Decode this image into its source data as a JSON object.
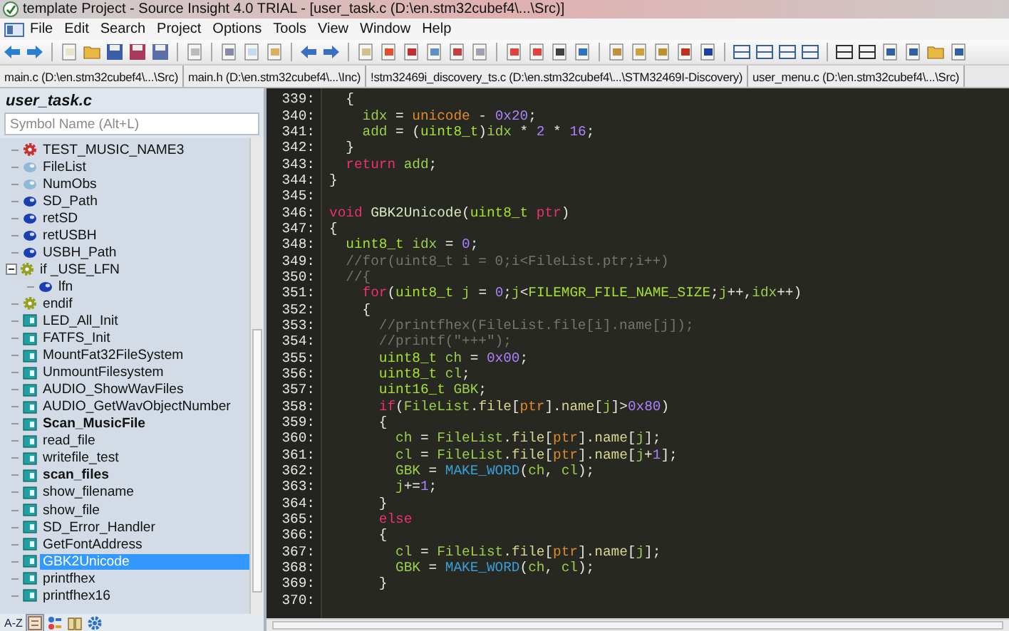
{
  "window": {
    "title": "template Project - Source Insight 4.0 TRIAL - [user_task.c (D:\\en.stm32cubef4\\...\\Src)]"
  },
  "menu": [
    "File",
    "Edit",
    "Search",
    "Project",
    "Options",
    "Tools",
    "View",
    "Window",
    "Help"
  ],
  "tabs": [
    {
      "label": "main.c (D:\\en.stm32cubef4\\...\\Src)",
      "selected": false
    },
    {
      "label": "main.h (D:\\en.stm32cubef4\\...\\Inc)",
      "selected": false
    },
    {
      "label": "!stm32469i_discovery_ts.c (D:\\en.stm32cubef4\\...\\STM32469I-Discovery)",
      "selected": false
    },
    {
      "label": "user_menu.c (D:\\en.stm32cubef4\\...\\Src)",
      "selected": false
    }
  ],
  "sidebar": {
    "title": "user_task.c",
    "search": {
      "placeholder": "Symbol Name (Alt+L)"
    },
    "sort_label": "A-Z",
    "items": [
      {
        "label": "TEST_MUSIC_NAME3",
        "kind": "define",
        "bold": false,
        "selected": false
      },
      {
        "label": "FileList",
        "kind": "variable-local",
        "bold": false,
        "selected": false
      },
      {
        "label": "NumObs",
        "kind": "variable-local",
        "bold": false,
        "selected": false
      },
      {
        "label": "SD_Path",
        "kind": "variable",
        "bold": false,
        "selected": false
      },
      {
        "label": "retSD",
        "kind": "variable",
        "bold": false,
        "selected": false
      },
      {
        "label": "retUSBH",
        "kind": "variable",
        "bold": false,
        "selected": false
      },
      {
        "label": "USBH_Path",
        "kind": "variable",
        "bold": false,
        "selected": false
      },
      {
        "label": "if _USE_LFN",
        "kind": "condition",
        "bold": false,
        "selected": false,
        "expanded": true,
        "children": [
          {
            "label": "lfn",
            "kind": "variable",
            "bold": false,
            "selected": false
          }
        ]
      },
      {
        "label": "endif",
        "kind": "condition",
        "bold": false,
        "selected": false
      },
      {
        "label": "LED_All_Init",
        "kind": "function",
        "bold": false,
        "selected": false
      },
      {
        "label": "FATFS_Init",
        "kind": "function",
        "bold": false,
        "selected": false
      },
      {
        "label": "MountFat32FileSystem",
        "kind": "function",
        "bold": false,
        "selected": false
      },
      {
        "label": "UnmountFilesystem",
        "kind": "function",
        "bold": false,
        "selected": false
      },
      {
        "label": "AUDIO_ShowWavFiles",
        "kind": "function",
        "bold": false,
        "selected": false
      },
      {
        "label": "AUDIO_GetWavObjectNumber",
        "kind": "function",
        "bold": false,
        "selected": false
      },
      {
        "label": "Scan_MusicFile",
        "kind": "function",
        "bold": true,
        "selected": false
      },
      {
        "label": "read_file",
        "kind": "function",
        "bold": false,
        "selected": false
      },
      {
        "label": "writefile_test",
        "kind": "function",
        "bold": false,
        "selected": false
      },
      {
        "label": "scan_files",
        "kind": "function",
        "bold": true,
        "selected": false
      },
      {
        "label": "show_filename",
        "kind": "function",
        "bold": false,
        "selected": false
      },
      {
        "label": "show_file",
        "kind": "function",
        "bold": false,
        "selected": false
      },
      {
        "label": "SD_Error_Handler",
        "kind": "function",
        "bold": false,
        "selected": false
      },
      {
        "label": "GetFontAddress",
        "kind": "function",
        "bold": false,
        "selected": false
      },
      {
        "label": "GBK2Unicode",
        "kind": "function",
        "bold": false,
        "selected": true
      },
      {
        "label": "printfhex",
        "kind": "function",
        "bold": false,
        "selected": false
      },
      {
        "label": "printfhex16",
        "kind": "function",
        "bold": false,
        "selected": false
      }
    ]
  },
  "editor": {
    "lines": [
      {
        "number": "339:",
        "tokens": [
          {
            "kind": "p",
            "text": "  {"
          }
        ]
      },
      {
        "number": "340:",
        "tokens": [
          {
            "kind": "id",
            "text": "    idx"
          },
          {
            "kind": "p",
            "text": " = "
          },
          {
            "kind": "param",
            "text": "unicode"
          },
          {
            "kind": "p",
            "text": " - "
          },
          {
            "kind": "num",
            "text": "0x20"
          },
          {
            "kind": "p",
            "text": ";"
          }
        ]
      },
      {
        "number": "341:",
        "tokens": [
          {
            "kind": "id",
            "text": "    add"
          },
          {
            "kind": "p",
            "text": " = ("
          },
          {
            "kind": "type",
            "text": "uint8_t"
          },
          {
            "kind": "p",
            "text": ")"
          },
          {
            "kind": "id",
            "text": "idx"
          },
          {
            "kind": "p",
            "text": " * "
          },
          {
            "kind": "num",
            "text": "2"
          },
          {
            "kind": "p",
            "text": " * "
          },
          {
            "kind": "num",
            "text": "16"
          },
          {
            "kind": "p",
            "text": ";"
          }
        ]
      },
      {
        "number": "342:",
        "tokens": [
          {
            "kind": "p",
            "text": "  }"
          }
        ]
      },
      {
        "number": "343:",
        "tokens": [
          {
            "kind": "kw",
            "text": "  return"
          },
          {
            "kind": "id",
            "text": " add"
          },
          {
            "kind": "p",
            "text": ";"
          }
        ]
      },
      {
        "number": "344:",
        "tokens": [
          {
            "kind": "p",
            "text": "}"
          }
        ]
      },
      {
        "number": "345:"
      },
      {
        "number": "346:",
        "tokens": [
          {
            "kind": "kw",
            "text": "void"
          },
          {
            "kind": "fn",
            "text": " GBK2Unicode"
          },
          {
            "kind": "p",
            "text": "("
          },
          {
            "kind": "type",
            "text": "uint8_t"
          },
          {
            "kind": "kw",
            "text": " ptr"
          },
          {
            "kind": "p",
            "text": ")"
          }
        ]
      },
      {
        "number": "347:",
        "tokens": [
          {
            "kind": "p",
            "text": "{"
          }
        ]
      },
      {
        "number": "348:",
        "tokens": [
          {
            "kind": "type",
            "text": "  uint8_t"
          },
          {
            "kind": "id",
            "text": " idx"
          },
          {
            "kind": "p",
            "text": " = "
          },
          {
            "kind": "num",
            "text": "0"
          },
          {
            "kind": "p",
            "text": ";"
          }
        ]
      },
      {
        "number": "349:",
        "tokens": [
          {
            "kind": "cm",
            "text": "  //for(uint8_t i = 0;i<FileList.ptr;i++)"
          }
        ]
      },
      {
        "number": "350:",
        "tokens": [
          {
            "kind": "cm",
            "text": "  //{"
          }
        ]
      },
      {
        "number": "351:",
        "tokens": [
          {
            "kind": "kw",
            "text": "    for"
          },
          {
            "kind": "p",
            "text": "("
          },
          {
            "kind": "type",
            "text": "uint8_t"
          },
          {
            "kind": "id",
            "text": " j"
          },
          {
            "kind": "p",
            "text": " = "
          },
          {
            "kind": "num",
            "text": "0"
          },
          {
            "kind": "p",
            "text": ";"
          },
          {
            "kind": "id",
            "text": "j"
          },
          {
            "kind": "p",
            "text": "<"
          },
          {
            "kind": "const",
            "text": "FILEMGR_FILE_NAME_SIZE"
          },
          {
            "kind": "p",
            "text": ";"
          },
          {
            "kind": "id",
            "text": "j"
          },
          {
            "kind": "p",
            "text": "++,"
          },
          {
            "kind": "id",
            "text": "idx"
          },
          {
            "kind": "p",
            "text": "++)"
          }
        ]
      },
      {
        "number": "352:",
        "tokens": [
          {
            "kind": "p",
            "text": "    {"
          }
        ]
      },
      {
        "number": "353:",
        "tokens": [
          {
            "kind": "cm",
            "text": "      //printfhex(FileList.file[i].name[j]);"
          }
        ]
      },
      {
        "number": "354:",
        "tokens": [
          {
            "kind": "cm",
            "text": "      //printf(\"+++\");"
          }
        ]
      },
      {
        "number": "355:",
        "tokens": [
          {
            "kind": "type",
            "text": "      uint8_t"
          },
          {
            "kind": "id",
            "text": " ch"
          },
          {
            "kind": "p",
            "text": " = "
          },
          {
            "kind": "num",
            "text": "0x00"
          },
          {
            "kind": "p",
            "text": ";"
          }
        ]
      },
      {
        "number": "356:",
        "tokens": [
          {
            "kind": "type",
            "text": "      uint8_t"
          },
          {
            "kind": "id",
            "text": " cl"
          },
          {
            "kind": "p",
            "text": ";"
          }
        ]
      },
      {
        "number": "357:",
        "tokens": [
          {
            "kind": "type",
            "text": "      uint16_t"
          },
          {
            "kind": "id",
            "text": " GBK"
          },
          {
            "kind": "p",
            "text": ";"
          }
        ]
      },
      {
        "number": "358:",
        "tokens": [
          {
            "kind": "kw",
            "text": "      if"
          },
          {
            "kind": "p",
            "text": "("
          },
          {
            "kind": "id",
            "text": "FileList"
          },
          {
            "kind": "p",
            "text": "."
          },
          {
            "kind": "mem",
            "text": "file"
          },
          {
            "kind": "p",
            "text": "["
          },
          {
            "kind": "param",
            "text": "ptr"
          },
          {
            "kind": "p",
            "text": "]."
          },
          {
            "kind": "mem",
            "text": "name"
          },
          {
            "kind": "p",
            "text": "["
          },
          {
            "kind": "id",
            "text": "j"
          },
          {
            "kind": "p",
            "text": "]>"
          },
          {
            "kind": "num",
            "text": "0x80"
          },
          {
            "kind": "p",
            "text": ")"
          }
        ]
      },
      {
        "number": "359:",
        "tokens": [
          {
            "kind": "p",
            "text": "      {"
          }
        ]
      },
      {
        "number": "360:",
        "tokens": [
          {
            "kind": "id",
            "text": "        ch"
          },
          {
            "kind": "p",
            "text": " = "
          },
          {
            "kind": "id",
            "text": "FileList"
          },
          {
            "kind": "p",
            "text": "."
          },
          {
            "kind": "mem",
            "text": "file"
          },
          {
            "kind": "p",
            "text": "["
          },
          {
            "kind": "param",
            "text": "ptr"
          },
          {
            "kind": "p",
            "text": "]."
          },
          {
            "kind": "mem",
            "text": "name"
          },
          {
            "kind": "p",
            "text": "["
          },
          {
            "kind": "id",
            "text": "j"
          },
          {
            "kind": "p",
            "text": "];"
          }
        ]
      },
      {
        "number": "361:",
        "tokens": [
          {
            "kind": "id",
            "text": "        cl"
          },
          {
            "kind": "p",
            "text": " = "
          },
          {
            "kind": "id",
            "text": "FileList"
          },
          {
            "kind": "p",
            "text": "."
          },
          {
            "kind": "mem",
            "text": "file"
          },
          {
            "kind": "p",
            "text": "["
          },
          {
            "kind": "param",
            "text": "ptr"
          },
          {
            "kind": "p",
            "text": "]."
          },
          {
            "kind": "mem",
            "text": "name"
          },
          {
            "kind": "p",
            "text": "["
          },
          {
            "kind": "id",
            "text": "j"
          },
          {
            "kind": "p",
            "text": "+"
          },
          {
            "kind": "num",
            "text": "1"
          },
          {
            "kind": "p",
            "text": "];"
          }
        ]
      },
      {
        "number": "362:",
        "tokens": [
          {
            "kind": "id",
            "text": "        GBK"
          },
          {
            "kind": "p",
            "text": " = "
          },
          {
            "kind": "mac",
            "text": "MAKE_WORD"
          },
          {
            "kind": "p",
            "text": "("
          },
          {
            "kind": "id",
            "text": "ch"
          },
          {
            "kind": "p",
            "text": ", "
          },
          {
            "kind": "id",
            "text": "cl"
          },
          {
            "kind": "p",
            "text": ");"
          }
        ]
      },
      {
        "number": "363:",
        "tokens": [
          {
            "kind": "id",
            "text": "        j"
          },
          {
            "kind": "p",
            "text": "+="
          },
          {
            "kind": "num",
            "text": "1"
          },
          {
            "kind": "p",
            "text": ";"
          }
        ]
      },
      {
        "number": "364:",
        "tokens": [
          {
            "kind": "p",
            "text": "      }"
          }
        ]
      },
      {
        "number": "365:",
        "tokens": [
          {
            "kind": "kw",
            "text": "      else"
          }
        ]
      },
      {
        "number": "366:",
        "tokens": [
          {
            "kind": "p",
            "text": "      {"
          }
        ]
      },
      {
        "number": "367:",
        "tokens": [
          {
            "kind": "id",
            "text": "        cl"
          },
          {
            "kind": "p",
            "text": " = "
          },
          {
            "kind": "id",
            "text": "FileList"
          },
          {
            "kind": "p",
            "text": "."
          },
          {
            "kind": "mem",
            "text": "file"
          },
          {
            "kind": "p",
            "text": "["
          },
          {
            "kind": "param",
            "text": "ptr"
          },
          {
            "kind": "p",
            "text": "]."
          },
          {
            "kind": "mem",
            "text": "name"
          },
          {
            "kind": "p",
            "text": "["
          },
          {
            "kind": "id",
            "text": "j"
          },
          {
            "kind": "p",
            "text": "];"
          }
        ]
      },
      {
        "number": "368:",
        "tokens": [
          {
            "kind": "id",
            "text": "        GBK"
          },
          {
            "kind": "p",
            "text": " = "
          },
          {
            "kind": "mac",
            "text": "MAKE_WORD"
          },
          {
            "kind": "p",
            "text": "("
          },
          {
            "kind": "id",
            "text": "ch"
          },
          {
            "kind": "p",
            "text": ", "
          },
          {
            "kind": "id",
            "text": "cl"
          },
          {
            "kind": "p",
            "text": ");"
          }
        ]
      },
      {
        "number": "369:",
        "tokens": [
          {
            "kind": "p",
            "text": "      }"
          }
        ]
      },
      {
        "number": "370:"
      }
    ]
  }
}
